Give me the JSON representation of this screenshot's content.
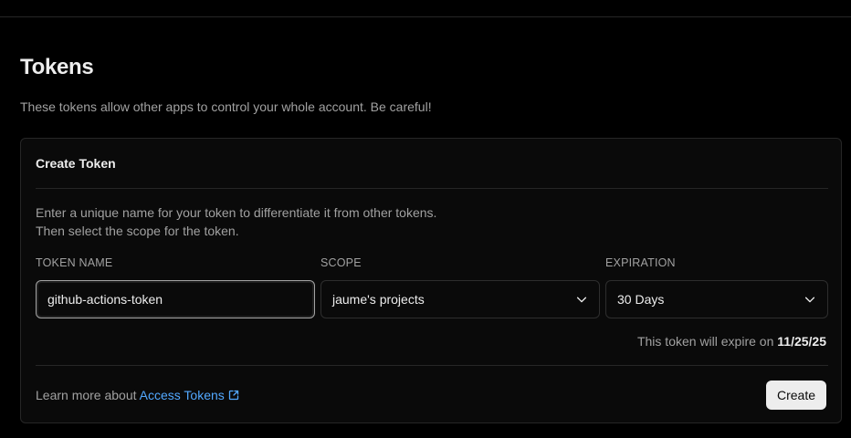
{
  "page": {
    "title": "Tokens",
    "description": "These tokens allow other apps to control your whole account. Be careful!"
  },
  "card": {
    "title": "Create Token",
    "instruction_line1": "Enter a unique name for your token to differentiate it from other tokens.",
    "instruction_line2": "Then select the scope for the token."
  },
  "form": {
    "token_name_label": "TOKEN NAME",
    "token_name_value": "github-actions-token",
    "scope_label": "SCOPE",
    "scope_value": "jaume's projects",
    "expiration_label": "EXPIRATION",
    "expiration_value": "30 Days",
    "expire_note_prefix": "This token will expire on",
    "expire_date": "11/25/25"
  },
  "footer": {
    "learn_prefix": "Learn more about",
    "learn_link": "Access Tokens",
    "create_label": "Create"
  },
  "icons": {
    "scope_chevron": "chevron-down-icon",
    "expiration_chevron": "chevron-down-icon",
    "external_link": "external-link-icon"
  }
}
